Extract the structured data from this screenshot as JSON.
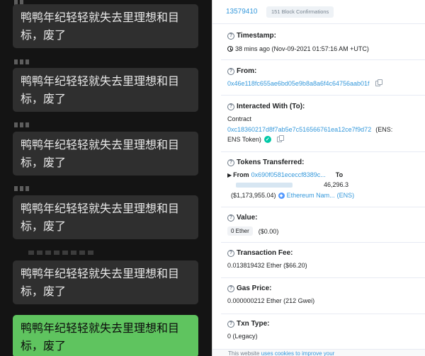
{
  "chat": {
    "messages": [
      {
        "text": "鸭鸭年纪轻轻就失去里理想和目标，废了",
        "kind": "received"
      },
      {
        "text": "鸭鸭年纪轻轻就失去里理想和目标，废了",
        "kind": "received"
      },
      {
        "text": "鸭鸭年纪轻轻就失去里理想和目标，废了",
        "kind": "received"
      },
      {
        "text": "鸭鸭年纪轻轻就失去里理想和目标，废了",
        "kind": "received"
      },
      {
        "text": "鸭鸭年纪轻轻就失去里理想和目标，废了",
        "kind": "received"
      },
      {
        "text": "鸭鸭年纪轻轻就失去里理想和目标，废了",
        "kind": "sent"
      }
    ]
  },
  "explorer": {
    "block_number": "13579410",
    "confirmations": "151 Block Confirmations",
    "timestamp": {
      "label": "Timestamp:",
      "value": "38 mins ago (Nov-09-2021 01:57:16 AM +UTC)"
    },
    "from": {
      "label": "From:",
      "address": "0x46e118fc655ae6bd05e9b8a8a6f4c64756aab01f"
    },
    "to": {
      "label": "Interacted With (To):",
      "contract_label": "Contract",
      "address": "0xc18360217d8f7ab5e7c516566761ea12ce7f9d72",
      "name_prefix": "(ENS:",
      "name": "ENS Token)"
    },
    "tokens": {
      "label": "Tokens Transferred:",
      "from_label": "From",
      "from_address": "0x690f0581ececcf8389c...",
      "to_label": "To",
      "amount": "46,296.3",
      "usd": "($1,173,955.04)",
      "token_name": "Ethereum Nam...",
      "token_symbol": "(ENS)"
    },
    "value": {
      "label": "Value:",
      "ether": "0 Ether",
      "usd": "($0.00)"
    },
    "fee": {
      "label": "Transaction Fee:",
      "value": "0.013819432 Ether ($66.20)"
    },
    "gas": {
      "label": "Gas Price:",
      "value": "0.000000212 Ether (212 Gwei)"
    },
    "txn_type": {
      "label": "Txn Type:",
      "value": "0 (Legacy)"
    },
    "footer": {
      "prefix": "This website",
      "link": "uses cookies to improve your"
    },
    "colors": {
      "link": "#3498db",
      "success": "#00c9a7"
    },
    "icons": [
      "question-icon",
      "clock-icon",
      "copy-icon",
      "check-icon",
      "ens-logo-icon"
    ]
  }
}
